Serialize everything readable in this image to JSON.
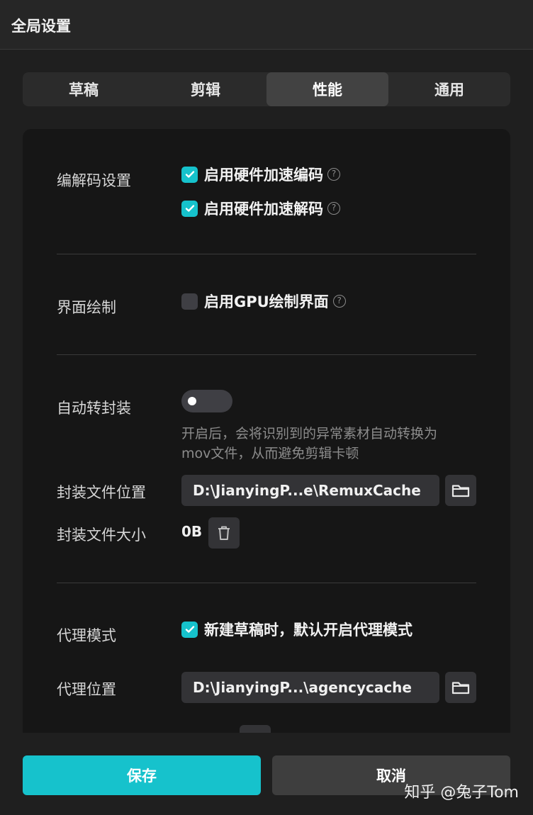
{
  "window": {
    "title": "全局设置"
  },
  "tabs": [
    {
      "label": "草稿",
      "active": false
    },
    {
      "label": "剪辑",
      "active": false
    },
    {
      "label": "性能",
      "active": true
    },
    {
      "label": "通用",
      "active": false
    }
  ],
  "codec": {
    "label": "编解码设置",
    "options": [
      {
        "label": "启用硬件加速编码",
        "checked": true
      },
      {
        "label": "启用硬件加速解码",
        "checked": true
      }
    ]
  },
  "render": {
    "label": "界面绘制",
    "option": {
      "label": "启用GPU绘制界面",
      "checked": false
    }
  },
  "remux": {
    "label": "自动转封装",
    "toggle_on": false,
    "hint_line1": "开启后，会将识别到的异常素材自动转换为",
    "hint_line2": "mov文件，从而避免剪辑卡顿",
    "location_label": "封装文件位置",
    "location_value": "D:\\JianyingP...e\\RemuxCache",
    "size_label": "封装文件大小",
    "size_value": "0B"
  },
  "proxy": {
    "label": "代理模式",
    "option": {
      "label": "新建草稿时，默认开启代理模式",
      "checked": true
    },
    "location_label": "代理位置",
    "location_value": "D:\\JianyingP...\\agencycache"
  },
  "footer": {
    "save_label": "保存",
    "cancel_label": "取消"
  },
  "watermark": "知乎 @兔子Tom",
  "colors": {
    "accent": "#16c2cc",
    "panel": "#161616",
    "background": "#1f1f1f"
  },
  "icons": [
    "check-icon",
    "help-icon",
    "folder-icon",
    "trash-icon"
  ]
}
